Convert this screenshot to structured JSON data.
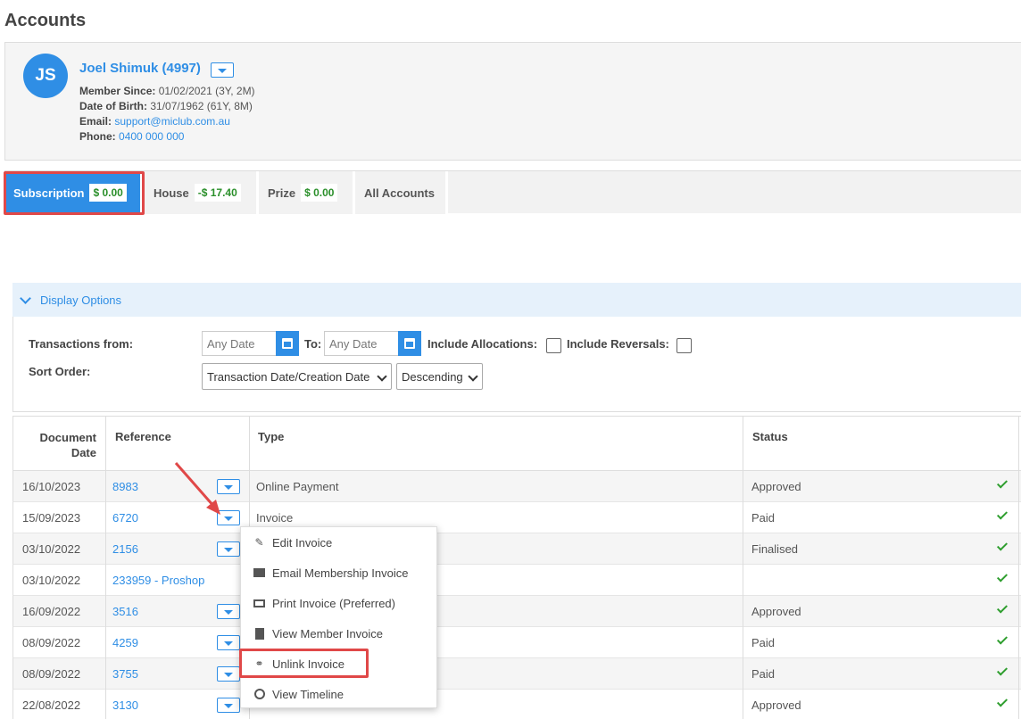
{
  "page": {
    "title": "Accounts"
  },
  "member": {
    "initials": "JS",
    "name": "Joel Shimuk (4997)",
    "member_since_label": "Member Since:",
    "member_since": "01/02/2021 (3Y, 2M)",
    "dob_label": "Date of Birth:",
    "dob": "31/07/1962 (61Y, 8M)",
    "email_label": "Email:",
    "email": "support@miclub.com.au",
    "phone_label": "Phone:",
    "phone": "0400 000 000"
  },
  "tabs": [
    {
      "label": "Subscription",
      "amount": "$ 0.00"
    },
    {
      "label": "House",
      "amount": "-$ 17.40"
    },
    {
      "label": "Prize",
      "amount": "$ 0.00"
    },
    {
      "label": "All Accounts"
    }
  ],
  "display_options": {
    "label": "Display Options",
    "transactions_from_label": "Transactions from:",
    "from_placeholder": "Any Date",
    "to_label": "To:",
    "to_placeholder": "Any Date",
    "include_allocations_label": "Include Allocations:",
    "include_reversals_label": "Include Reversals:",
    "sort_order_label": "Sort Order:",
    "sort_field": "Transaction Date/Creation Date",
    "sort_direction": "Descending"
  },
  "table": {
    "headers": {
      "date_line1": "Document",
      "date_line2": "Date",
      "reference": "Reference",
      "type": "Type",
      "status": "Status"
    },
    "rows": [
      {
        "date": "16/10/2023",
        "reference": "8983",
        "type": "Online Payment",
        "status": "Approved"
      },
      {
        "date": "15/09/2023",
        "reference": "6720",
        "type": "Invoice",
        "status": "Paid"
      },
      {
        "date": "03/10/2022",
        "reference": "2156",
        "type": "",
        "status": "Finalised"
      },
      {
        "date": "03/10/2022",
        "reference": "233959 - Proshop",
        "type": "",
        "status": ""
      },
      {
        "date": "16/09/2022",
        "reference": "3516",
        "type": "",
        "status": "Approved"
      },
      {
        "date": "08/09/2022",
        "reference": "4259",
        "type": "",
        "status": "Paid"
      },
      {
        "date": "08/09/2022",
        "reference": "3755",
        "type": "",
        "status": "Paid"
      },
      {
        "date": "22/08/2022",
        "reference": "3130",
        "type": "",
        "status": "Approved"
      }
    ]
  },
  "context_menu": {
    "items": [
      {
        "label": "Edit Invoice",
        "icon": "pencil-icon"
      },
      {
        "label": "Email Membership Invoice",
        "icon": "envelope-icon"
      },
      {
        "label": "Print Invoice (Preferred)",
        "icon": "print-icon"
      },
      {
        "label": "View Member Invoice",
        "icon": "file-icon"
      },
      {
        "label": "Unlink Invoice",
        "icon": "link-icon"
      },
      {
        "label": "View Timeline",
        "icon": "clock-icon"
      }
    ]
  },
  "colors": {
    "accent": "#2f8ee5",
    "highlight": "#e04848",
    "success": "#2e9e2e"
  }
}
